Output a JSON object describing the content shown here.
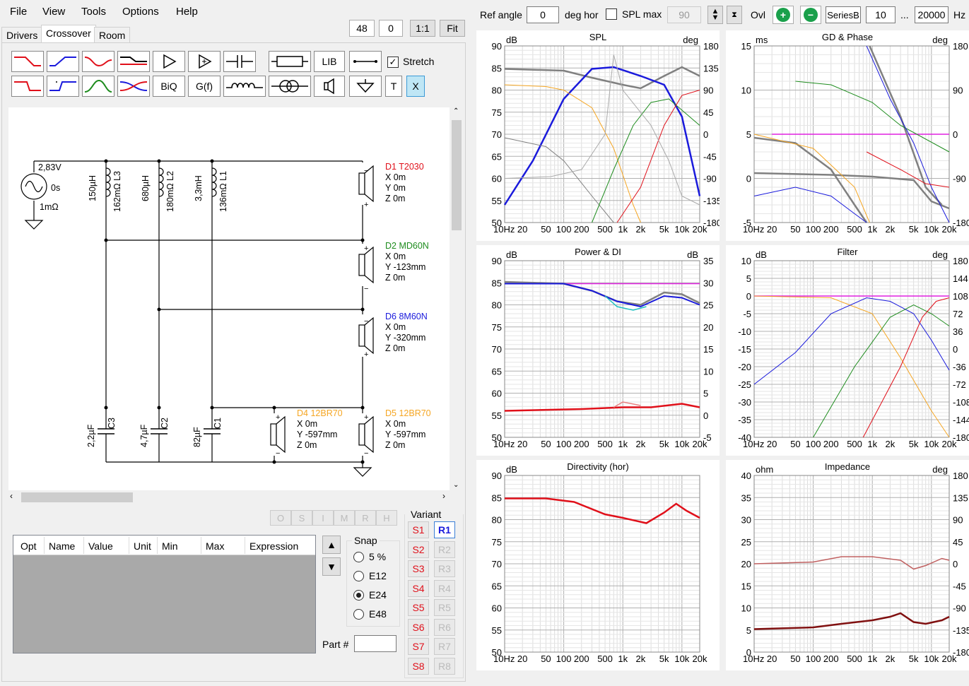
{
  "menu": [
    "File",
    "View",
    "Tools",
    "Options",
    "Help"
  ],
  "tabs": [
    "Drivers",
    "Crossover",
    "Room"
  ],
  "zoom": {
    "a": "48",
    "b": "0",
    "one": "1:1",
    "fit": "Fit"
  },
  "toolbar": {
    "lib": "LIB",
    "biq": "BiQ",
    "gf": "G(f)",
    "t": "T",
    "x": "X",
    "stretch": "Stretch"
  },
  "top": {
    "ref_angle_label": "Ref angle",
    "ref_angle": "0",
    "deg_hor": "deg hor",
    "spl_max": "SPL max",
    "spl_max_val": "90",
    "ovl": "Ovl",
    "series": "SeriesB",
    "f_lo": "10",
    "ellipsis": "...",
    "f_hi": "20000",
    "hz": "Hz"
  },
  "source": {
    "v": "2,83V",
    "t": "0s",
    "r": "1mΩ"
  },
  "components": {
    "l3": [
      "150µH",
      "162mΩ L3"
    ],
    "l2": [
      "680µH",
      "180mΩ L2"
    ],
    "l1": [
      "3,3mH",
      "136mΩ L1"
    ],
    "c3": [
      "2,2µF",
      "C3"
    ],
    "c2": [
      "4,7µF",
      "C2"
    ],
    "c1": [
      "82µF",
      "C1"
    ]
  },
  "drivers": [
    {
      "name": "D1 T2030",
      "x": "X 0m",
      "y": "Y 0m",
      "z": "Z 0m",
      "color": "#e0101a"
    },
    {
      "name": "D2 MD60N",
      "x": "X 0m",
      "y": "Y -123mm",
      "z": "Z 0m",
      "color": "#1e8c1e"
    },
    {
      "name": "D6 8M60N",
      "x": "X 0m",
      "y": "Y -320mm",
      "z": "Z 0m",
      "color": "#1a1adc"
    },
    {
      "name": "D4 12BR70",
      "x": "X 0m",
      "y": "Y -597mm",
      "z": "Z 0m",
      "color": "#f5a623"
    },
    {
      "name": "D5 12BR70",
      "x": "X 0m",
      "y": "Y -597mm",
      "z": "Z 0m",
      "color": "#f5a623"
    }
  ],
  "opt_buttons": [
    "O",
    "S",
    "I",
    "M",
    "R",
    "H"
  ],
  "table_headers": [
    "Opt",
    "Name",
    "Value",
    "Unit",
    "Min",
    "Max",
    "Expression"
  ],
  "snap": {
    "title": "Snap",
    "options": [
      "5 %",
      "E12",
      "E24",
      "E48"
    ],
    "selected": "E24"
  },
  "part_label": "Part #",
  "variant": {
    "title": "Variant",
    "s": [
      "S1",
      "S2",
      "S3",
      "S4",
      "S5",
      "S6",
      "S7",
      "S8"
    ],
    "r": [
      "R1",
      "R2",
      "R3",
      "R4",
      "R5",
      "R6",
      "R7",
      "R8"
    ]
  },
  "xticks": [
    "10Hz",
    "20",
    "50",
    "100",
    "200",
    "500",
    "1k",
    "2k",
    "5k",
    "10k",
    "20k"
  ],
  "graphs": [
    {
      "title": "SPL",
      "lunit": "dB",
      "runit": "deg",
      "left": [
        "90",
        "85",
        "80",
        "75",
        "70",
        "65",
        "60",
        "55",
        "50"
      ],
      "right": [
        "180",
        "135",
        "90",
        "45",
        "0",
        "-45",
        "-90",
        "-135",
        "-180"
      ]
    },
    {
      "title": "GD & Phase",
      "lunit": "ms",
      "runit": "deg",
      "left": [
        "15",
        "10",
        "5",
        "0",
        "-5"
      ],
      "right": [
        "180",
        "90",
        "0",
        "-90",
        "-180"
      ]
    },
    {
      "title": "Power & DI",
      "lunit": "dB",
      "runit": "dB",
      "left": [
        "90",
        "85",
        "80",
        "75",
        "70",
        "65",
        "60",
        "55",
        "50"
      ],
      "right": [
        "35",
        "30",
        "25",
        "20",
        "15",
        "10",
        "5",
        "0",
        "-5"
      ]
    },
    {
      "title": "Filter",
      "lunit": "dB",
      "runit": "deg",
      "left": [
        "10",
        "5",
        "0",
        "-5",
        "-10",
        "-15",
        "-20",
        "-25",
        "-30",
        "-35",
        "-40"
      ],
      "right": [
        "180",
        "144",
        "108",
        "72",
        "36",
        "0",
        "-36",
        "-72",
        "-108",
        "-144",
        "-180"
      ]
    },
    {
      "title": "Directivity (hor)",
      "lunit": "dB",
      "runit": "",
      "left": [
        "90",
        "85",
        "80",
        "75",
        "70",
        "65",
        "60",
        "55",
        "50"
      ],
      "right": []
    },
    {
      "title": "Impedance",
      "lunit": "ohm",
      "runit": "deg",
      "left": [
        "40",
        "35",
        "30",
        "25",
        "20",
        "15",
        "10",
        "5",
        "0"
      ],
      "right": [
        "180",
        "135",
        "90",
        "45",
        "0",
        "-45",
        "-90",
        "-135",
        "-180"
      ]
    }
  ],
  "colors": {
    "red": "#e0101a",
    "green": "#1e8c1e",
    "blue": "#1a1adc",
    "orange": "#f5a623",
    "magenta": "#e020e0",
    "gray": "#808080"
  }
}
